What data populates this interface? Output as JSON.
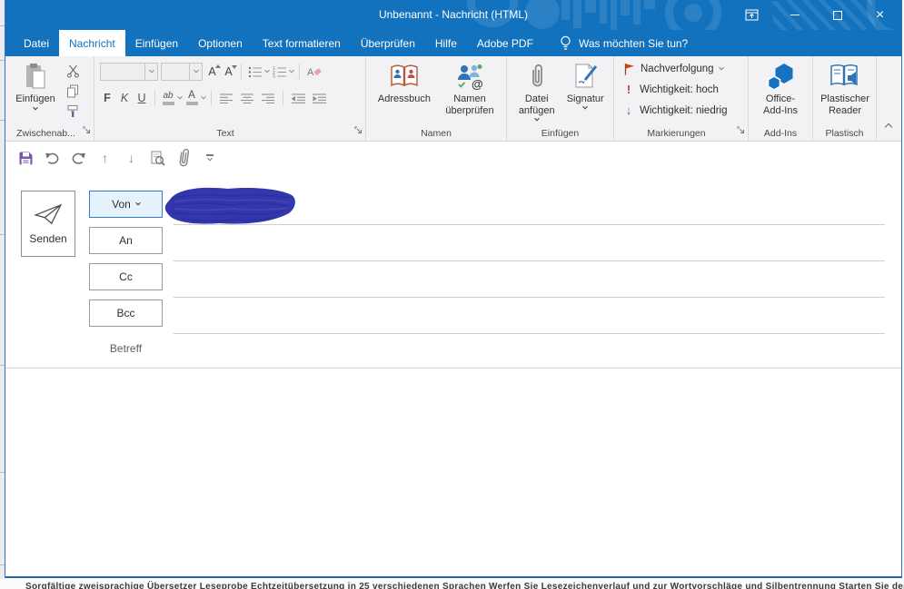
{
  "window": {
    "title": "Unbenannt  -  Nachricht (HTML)"
  },
  "tabs": [
    {
      "label": "Datei"
    },
    {
      "label": "Nachricht"
    },
    {
      "label": "Einfügen"
    },
    {
      "label": "Optionen"
    },
    {
      "label": "Text formatieren"
    },
    {
      "label": "Überprüfen"
    },
    {
      "label": "Hilfe"
    },
    {
      "label": "Adobe PDF"
    }
  ],
  "tell_me": {
    "label": "Was möchten Sie tun?"
  },
  "ribbon": {
    "clipboard": {
      "group_label": "Zwischenab...",
      "paste_label": "Einfügen"
    },
    "text": {
      "group_label": "Text",
      "bold": "F",
      "italic": "K",
      "underline": "U",
      "highlight": "ab",
      "font_color": "A",
      "grow": "A",
      "shrink": "A"
    },
    "names": {
      "group_label": "Namen",
      "address_book": "Adressbuch",
      "check_names_line1": "Namen",
      "check_names_line2": "überprüfen"
    },
    "include": {
      "group_label": "Einfügen",
      "attach_line1": "Datei",
      "attach_line2": "anfügen",
      "signature": "Signatur"
    },
    "tags": {
      "group_label": "Markierungen",
      "follow_up": "Nachverfolgung",
      "importance_high": "Wichtigkeit: hoch",
      "importance_low": "Wichtigkeit: niedrig"
    },
    "addins": {
      "group_label": "Add-Ins",
      "button_line1": "Office-",
      "button_line2": "Add-Ins"
    },
    "reader": {
      "group_label": "Plastisch",
      "button_line1": "Plastischer",
      "button_line2": "Reader"
    }
  },
  "compose": {
    "send": "Senden",
    "from": "Von",
    "to": "An",
    "cc": "Cc",
    "bcc": "Bcc",
    "subject": "Betreff"
  },
  "background_window": {
    "clipped_text": "Sorgfältige zweisprachige Übersetzer Leseprobe  Echtzeitübersetzung in 25 verschiedenen Sprachen  Werfen Sie Lesezeichenverlauf und zur Wortvorschläge und Silbentrennung  Starten Sie den Plastischen Reader und passen Sie Textabstand, Seitenfarben und das..."
  },
  "colors": {
    "titlebar_blue": "#1272BE",
    "tab_active_text": "#1272BE",
    "ribbon_bg": "#F2F1F3",
    "save_purple": "#7B56A8",
    "flag_red": "#D83B01",
    "importance_high_red": "#C43E3E",
    "importance_low_blue": "#2E74B5",
    "addin_blue": "#1673C1",
    "from_button_border": "#2B7CD3",
    "from_button_bg": "#E6F2FB",
    "scribble_ink": "#3336AC"
  },
  "icons": {
    "close_glyph": "×"
  }
}
